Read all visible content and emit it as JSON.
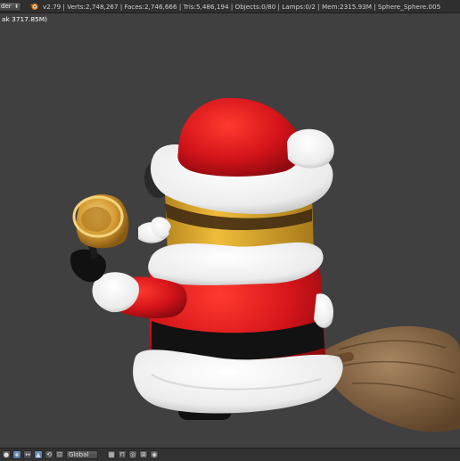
{
  "header": {
    "render_engine_label": "der",
    "stats_text": "v2.79 | Verts:2,748,267 | Faces:2,746,666 | Tris:5,486,194 | Objects:0/80 | Lamps:0/2 | Mem:2315.93M | Sphere_Sphere.005"
  },
  "viewport": {
    "info_label": "ak 3717.85M)",
    "background_color": "#404040",
    "object": "santa-minion-on-broom"
  },
  "bottom_bar": {
    "orientation_label": "Global",
    "tools": [
      "viewport-shading-icon",
      "pivot-icon",
      "manipulator-icon",
      "translate-icon",
      "rotate-icon",
      "scale-icon",
      "orientation-select",
      "layer-icon",
      "snap-icon",
      "proportional-icon",
      "lock-icon",
      "render-icon"
    ]
  },
  "colors": {
    "hat_red": "#d6161b",
    "fur_white": "#f2f2f2",
    "skin_yellow": "#e6b22c",
    "belt_black": "#121212",
    "broom_brown": "#8a6a47",
    "bell_gold": "#d9a43a"
  }
}
